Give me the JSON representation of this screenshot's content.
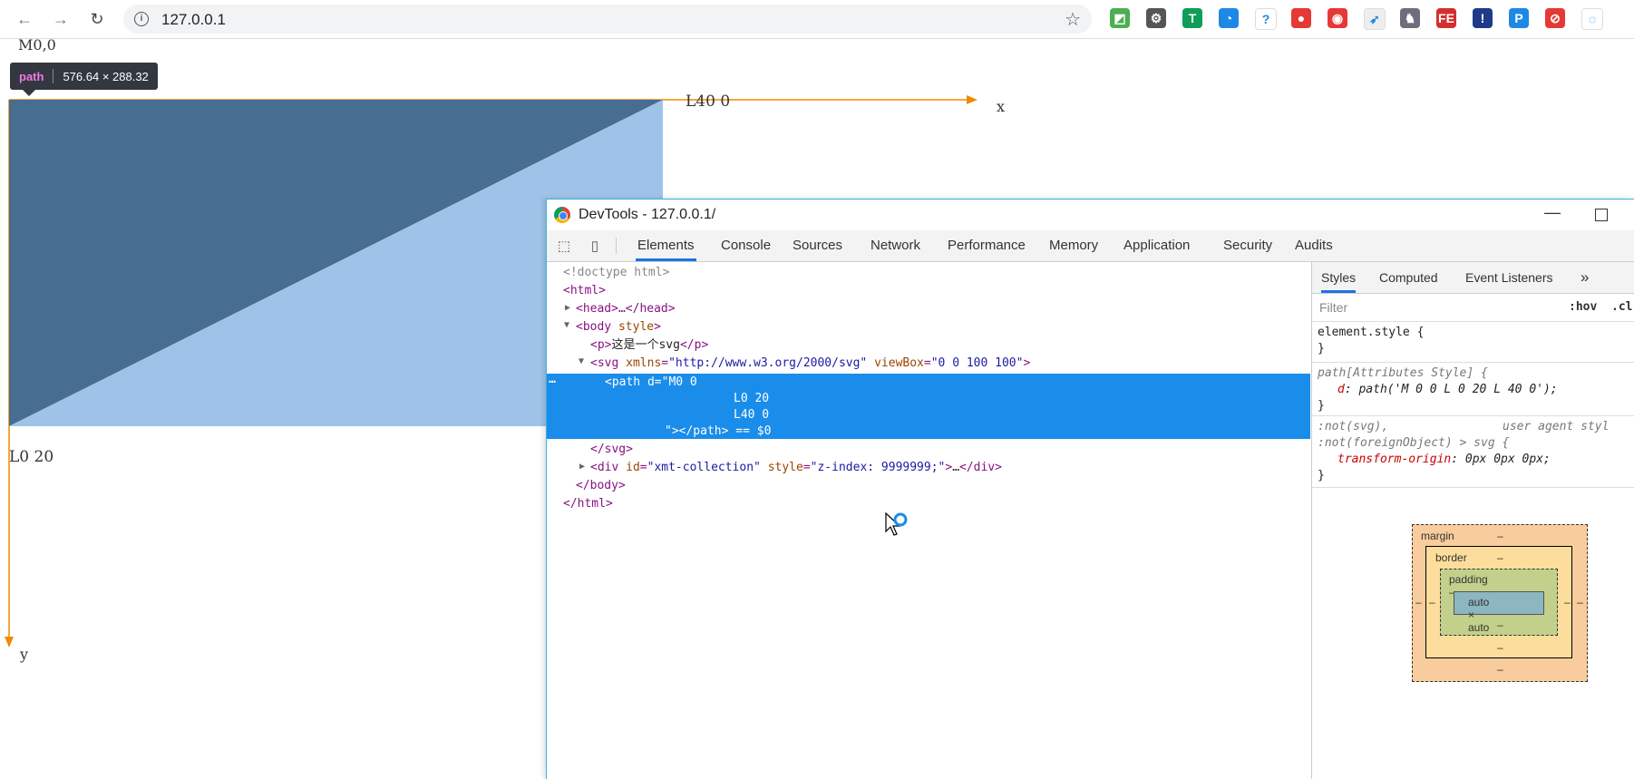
{
  "browser": {
    "url": "127.0.0.1",
    "extensions": [
      {
        "name": "colorful-extension-icon",
        "color": "#4caf50",
        "glyph": "◩"
      },
      {
        "name": "gear-extension-icon",
        "color": "#555555",
        "glyph": "⚙"
      },
      {
        "name": "shield-extension-icon",
        "color": "#0f9d58",
        "glyph": "T"
      },
      {
        "name": "compass-extension-icon",
        "color": "#1e88e5",
        "glyph": "◔"
      },
      {
        "name": "help-extension-icon",
        "color": "#ffffff",
        "glyph": "?"
      },
      {
        "name": "map-pin-extension-icon",
        "color": "#e53935",
        "glyph": "●"
      },
      {
        "name": "red-circle-extension-icon",
        "color": "#e53935",
        "glyph": "◉"
      },
      {
        "name": "rocket-extension-icon",
        "color": "#eeeeee",
        "glyph": "➶"
      },
      {
        "name": "cat-extension-icon",
        "color": "#6d6d7d",
        "glyph": "♞"
      },
      {
        "name": "fe-extension-icon",
        "color": "#d32f2f",
        "glyph": "FE"
      },
      {
        "name": "info-extension-icon",
        "color": "#1e3a8a",
        "glyph": "!"
      },
      {
        "name": "p-extension-icon",
        "color": "#1e88e5",
        "glyph": "P"
      },
      {
        "name": "block-extension-icon",
        "color": "#e53935",
        "glyph": "⊘"
      },
      {
        "name": "loading-extension-icon",
        "color": "#ffffff",
        "glyph": "◌"
      }
    ]
  },
  "page": {
    "label_m": "M0,0",
    "label_l40": "L40 0",
    "label_l20": "L0 20",
    "axis_x": "x",
    "axis_y": "y",
    "tooltip_tag": "path",
    "tooltip_size": "576.64 × 288.32"
  },
  "devtools": {
    "title": "DevTools - 127.0.0.1/",
    "tabs": [
      "Elements",
      "Console",
      "Sources",
      "Network",
      "Performance",
      "Memory",
      "Application",
      "Security",
      "Audits"
    ],
    "active_tab": "Elements",
    "dom": {
      "doctype": "<!doctype html>",
      "html_open": "<html>",
      "head": "<head>…</head>",
      "body_open_tag": "<body",
      "body_attr": "style",
      "p_text": "这是一个svg",
      "svg_attr1": "xmlns",
      "svg_val1": "\"http://www.w3.org/2000/svg\"",
      "svg_attr2": "viewBox",
      "svg_val2": "\"0 0 100 100\"",
      "path_line1": "<path d=\"M0 0",
      "path_line2": "L0 20",
      "path_line3": "L40 0",
      "path_line4": "\"></path> == $0",
      "svg_close": "</svg>",
      "div_id": "\"xmt-collection\"",
      "div_style": "\"z-index: 9999999;\"",
      "body_close": "</body>",
      "html_close": "</html>",
      "ellipsis": "…"
    },
    "styles": {
      "tabs": [
        "Styles",
        "Computed",
        "Event Listeners"
      ],
      "more": "»",
      "filter_placeholder": "Filter",
      "hov": ":hov",
      "cls": ".cl",
      "element_style": "element.style {",
      "close_brace": "}",
      "path_rule": "path[Attributes Style] {",
      "d_prop": "d",
      "d_value": "path('M 0 0 L 0 20 L 40 0');",
      "ua_selector1": ":not(svg),",
      "ua_label": "user agent styl",
      "ua_selector2": ":not(foreignObject) > svg {",
      "transform_prop": "transform-origin",
      "transform_value": "0px 0px 0px;"
    },
    "boxmodel": {
      "margin": "margin",
      "border": "border",
      "padding": "padding",
      "content": "auto × auto",
      "dash": "–"
    }
  },
  "colors": {
    "triangle_dark": "#476d91",
    "triangle_light": "#9fc3e8",
    "axis": "#ef8a00",
    "selection": "#1a8cea"
  }
}
